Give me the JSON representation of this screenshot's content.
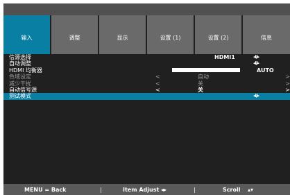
{
  "tabs": [
    {
      "label": "输入",
      "active": true
    },
    {
      "label": "调整",
      "active": false
    },
    {
      "label": "显示",
      "active": false
    },
    {
      "label": "设置 (1)",
      "active": false
    },
    {
      "label": "设置 (2)",
      "active": false
    },
    {
      "label": "信息",
      "active": false
    }
  ],
  "rows": {
    "source": {
      "label": "信源选择",
      "value": "HDMI1",
      "adjust": "◂I/▸"
    },
    "auto_adjust": {
      "label": "自动调整",
      "adjust": "◂I/▸"
    },
    "hdmi_eq": {
      "label": "HDMI 均衡器",
      "value": "AUTO"
    },
    "color_space": {
      "label": "色域设定",
      "left_arrow": "<",
      "value": "自动",
      "right_arrow": ">"
    },
    "noise_reduction": {
      "label": "减少干扰",
      "left_arrow": "<",
      "value": "关",
      "right_arrow": ">"
    },
    "auto_signal": {
      "label": "自动信号源",
      "left_arrow": "<",
      "value": "关",
      "right_arrow": ">"
    },
    "test_pattern": {
      "label": "测试模式",
      "adjust": "◂I/▸"
    }
  },
  "footer": {
    "menu_back": "MENU = Back",
    "separator": "|",
    "item_adjust": "Item Adjust",
    "item_adjust_icon": "◂▸",
    "scroll": "Scroll",
    "scroll_icon": "▴▾"
  },
  "colors": {
    "accent": "#0a7fa4",
    "tab_inactive": "#6a6a6a",
    "background": "#202020",
    "footer": "#5a5a5a",
    "disabled_text": "#9a9a9a"
  }
}
